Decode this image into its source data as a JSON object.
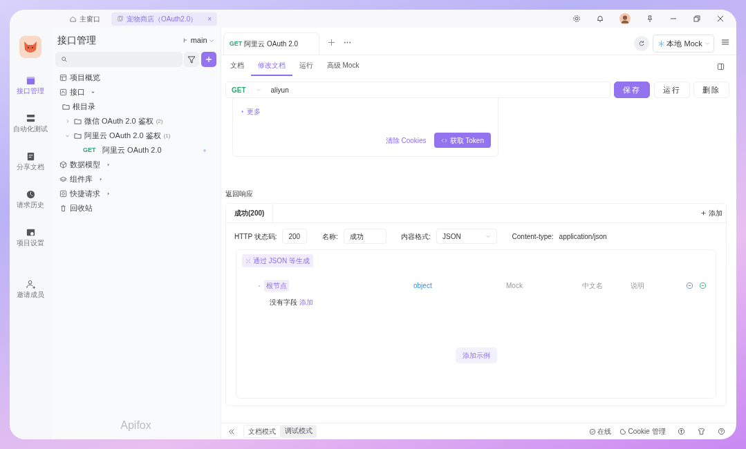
{
  "window_tabs": [
    {
      "label": "主窗口",
      "selected": false
    },
    {
      "label": "宠物商店（OAuth2.0）",
      "selected": true,
      "close": "×"
    }
  ],
  "rail": [
    {
      "label": "接口管理",
      "selected": true
    },
    {
      "label": "自动化测试",
      "selected": false
    },
    {
      "label": "分享文档",
      "selected": false
    },
    {
      "label": "请求历史",
      "selected": false
    },
    {
      "label": "项目设置",
      "selected": false
    },
    {
      "label": "邀请成员",
      "selected": false
    }
  ],
  "sidebar": {
    "title": "接口管理",
    "branch": "main",
    "brand": "Apifox",
    "tree": [
      {
        "kind": "section",
        "label": "项目概览"
      },
      {
        "kind": "section",
        "label": "接口",
        "expanded": true,
        "children": [
          {
            "kind": "folder",
            "label": "根目录"
          },
          {
            "kind": "folder",
            "label": "微信 OAuth 2.0 鉴权",
            "count": "(2)",
            "expanded": false
          },
          {
            "kind": "folder",
            "label": "阿里云 OAuth 2.0 鉴权",
            "count": "(1)",
            "expanded": true,
            "children": [
              {
                "kind": "endpoint",
                "method": "GET",
                "label": "阿里云 OAuth 2.0"
              }
            ]
          }
        ]
      },
      {
        "kind": "section",
        "label": "数据模型",
        "expanded": false
      },
      {
        "kind": "section",
        "label": "组件库",
        "expanded": false
      },
      {
        "kind": "section",
        "label": "快捷请求",
        "expanded": false
      },
      {
        "kind": "section",
        "label": "回收站"
      }
    ]
  },
  "request_tab": {
    "method": "GET",
    "label": "阿里云 OAuth 2.0"
  },
  "environment": "本地 Mock",
  "doc_tabs": [
    {
      "label": "文档",
      "selected": false
    },
    {
      "label": "修改文档",
      "selected": true
    },
    {
      "label": "运行",
      "selected": false
    },
    {
      "label": "高级 Mock",
      "selected": false
    }
  ],
  "url_bar": {
    "method": "GET",
    "value": "aliyun"
  },
  "actions": [
    {
      "label": "保存",
      "kind": "primary"
    },
    {
      "label": "运行",
      "kind": "plain"
    },
    {
      "label": "删除",
      "kind": "plain"
    }
  ],
  "auth_panel": {
    "more": "更多",
    "clear": "清除 Cookies",
    "get_token": "获取 Token"
  },
  "response": {
    "title": "返回响应",
    "tabs": [
      {
        "label": "成功(200)",
        "selected": true
      }
    ],
    "add": "添加",
    "fields": [
      {
        "label": "HTTP 状态码:",
        "value": "200",
        "kind": "input"
      },
      {
        "label": "名称:",
        "value": "成功",
        "kind": "input"
      },
      {
        "label": "内容格式:",
        "value": "JSON",
        "kind": "select"
      },
      {
        "label": "Content-type:",
        "value": "application/json",
        "kind": "text"
      }
    ],
    "generate": "通过 JSON 等生成",
    "schema": {
      "root": "根节点",
      "type": "object",
      "mock": "Mock",
      "title": "中文名",
      "description": "说明",
      "empty": "没有字段",
      "add": "添加"
    },
    "add_example": "添加示例"
  },
  "footer": {
    "modes": [
      {
        "label": "文档模式",
        "selected": true
      },
      {
        "label": "调试模式",
        "selected": false
      }
    ],
    "online": "在线",
    "cookies": "Cookie 管理"
  }
}
